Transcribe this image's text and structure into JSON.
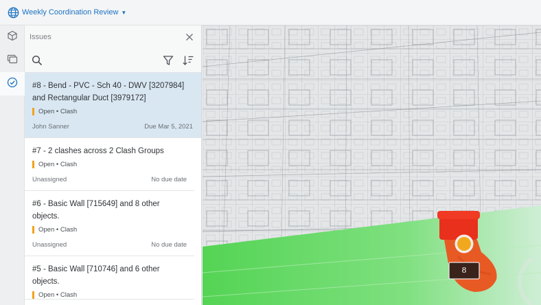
{
  "header": {
    "project_name": "Weekly Coordination Review"
  },
  "panel": {
    "title": "Issues"
  },
  "issues": [
    {
      "title": "#8 - Bend - PVC - Sch 40 - DWV [3207984] and Rectangular Duct [3979172]",
      "status": "Open • Clash",
      "assignee": "John Sanner",
      "due": "Due Mar 5, 2021"
    },
    {
      "title": "#7 - 2 clashes across 2 Clash Groups",
      "status": "Open • Clash",
      "assignee": "Unassigned",
      "due": "No due date"
    },
    {
      "title": "#6 - Basic Wall [715649] and 8 other objects.",
      "status": "Open • Clash",
      "assignee": "Unassigned",
      "due": "No due date"
    },
    {
      "title": "#5 - Basic Wall [710746] and 6 other objects.",
      "status": "Open • Clash",
      "assignee": "",
      "due": ""
    }
  ],
  "viewport": {
    "pin_label": "8"
  },
  "colors": {
    "accent": "#1d73c2",
    "status_open": "#f2a21b",
    "selected_row": "#d9e7f2",
    "floor": "#6fdc6f",
    "clash_red": "#e8301c"
  }
}
